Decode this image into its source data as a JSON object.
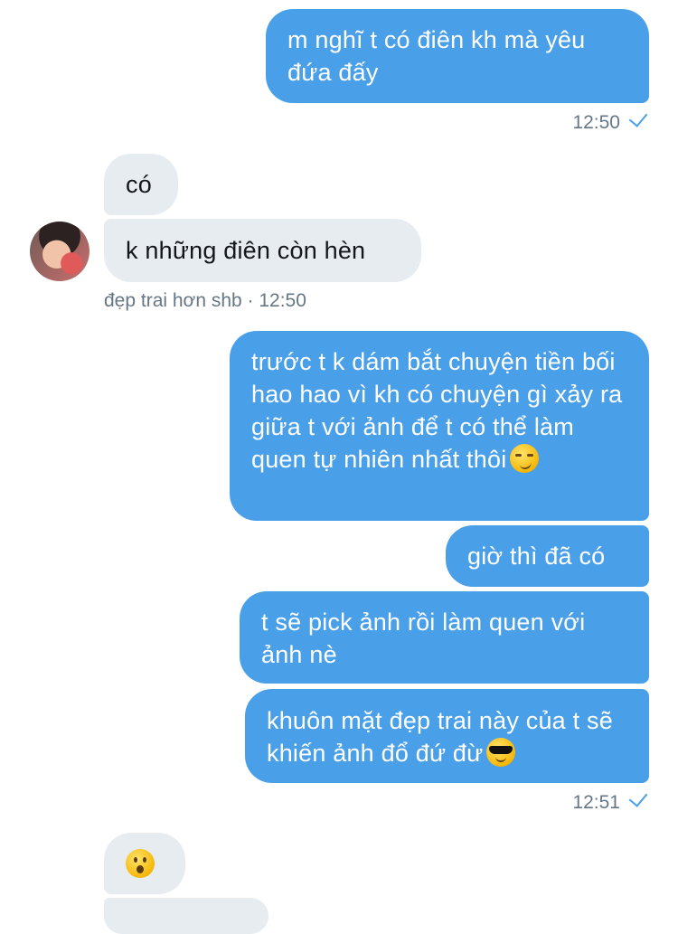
{
  "messages": {
    "m1": "m nghĩ t có điên kh mà yêu đứa đấy",
    "m1_time": "12:50",
    "m2": "có",
    "m3": "k những điên còn hèn",
    "sender_meta": "đẹp trai hơn shb · 12:50",
    "m4": "trước t k dám bắt chuyện tiền bối hao hao vì kh có chuyện gì xảy ra giữa t với ảnh để t có thể làm quen tự nhiên nhất thôi",
    "m5": "giờ thì đã có",
    "m6": "t sẽ pick ảnh rồi làm quen với ảnh nè",
    "m7": "khuôn mặt đẹp trai này của t sẽ khiến ảnh đổ đứ đừ",
    "m7_time": "12:51"
  },
  "icons": {
    "smirk": "smirking-face-emoji",
    "cool": "sunglasses-face-emoji",
    "wow": "hushed-face-emoji",
    "check": "sent-check-icon"
  },
  "colors": {
    "outgoing_bubble": "#4a9fe9",
    "incoming_bubble": "#e6ecf0",
    "meta_text": "#657786"
  }
}
